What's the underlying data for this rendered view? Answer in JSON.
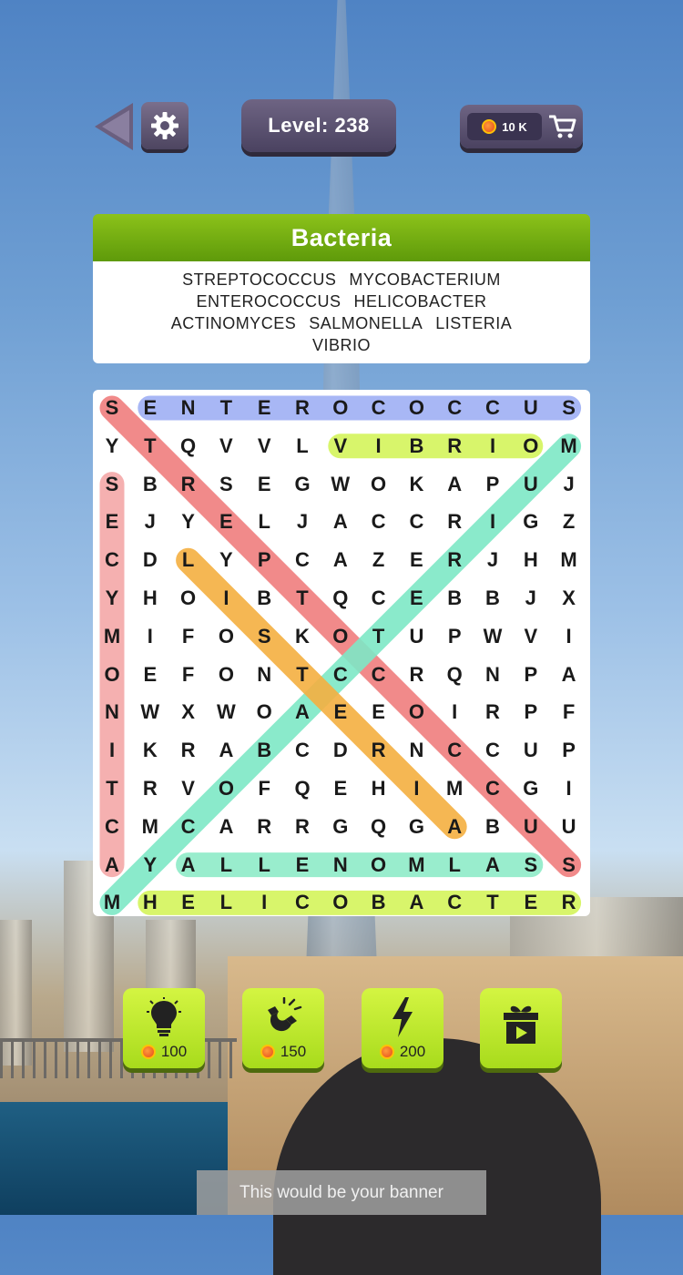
{
  "header": {
    "level_label": "Level: 238",
    "coins": "10 K",
    "icons": {
      "back": "back-arrow-icon",
      "settings": "gear-icon",
      "coin": "coin-icon",
      "cart": "shopping-cart-icon"
    }
  },
  "puzzle": {
    "category": "Bacteria",
    "words": [
      "STREPTOCOCCUS",
      "MYCOBACTERIUM",
      "ENTEROCOCCUS",
      "HELICOBACTER",
      "ACTINOMYCES",
      "SALMONELLA",
      "LISTERIA",
      "VIBRIO"
    ],
    "grid": [
      "SENTEROCOCCUS",
      "YTQVVLVIBRIOM",
      "SBRSEGWOKAPUJ",
      "EJYELJACCRIGZ",
      "CDLYPCAZERJHM",
      "YHOIBTQCEBBJX",
      "MIFOSKOTUPWVI",
      "OEFONTCCRQNPA",
      "NWXWOAEEOIRPF",
      "IKRABCDRNCCUP",
      "TRVOFQEHIMCGI",
      "CMCARRGQGABUU",
      "AYALLENOMLASS",
      "MHELICOBACTER"
    ],
    "found": [
      {
        "word": "ENTEROCOCCUS",
        "from": [
          0,
          1
        ],
        "to": [
          0,
          12
        ],
        "color": "#9fb0f5"
      },
      {
        "word": "VIBRIO",
        "from": [
          1,
          6
        ],
        "to": [
          1,
          11
        ],
        "color": "#d4f55c"
      },
      {
        "word": "STREPTOCOCCUS",
        "from": [
          0,
          0
        ],
        "to": [
          12,
          12
        ],
        "color": "#f07e7e"
      },
      {
        "word": "MYCOBACTERIUM",
        "from": [
          13,
          0
        ],
        "to": [
          1,
          12
        ],
        "color": "#7ee8c6"
      },
      {
        "word": "ACTINOMYCES",
        "from": [
          12,
          0
        ],
        "to": [
          2,
          0
        ],
        "color": "#f5a8a8"
      },
      {
        "word": "LISTERIA",
        "from": [
          4,
          2
        ],
        "to": [
          11,
          9
        ],
        "color": "#f5b041"
      },
      {
        "word": "SALMONELLA",
        "from": [
          12,
          11
        ],
        "to": [
          12,
          2
        ],
        "color": "#8fecc8"
      },
      {
        "word": "HELICOBACTER",
        "from": [
          13,
          1
        ],
        "to": [
          13,
          12
        ],
        "color": "#d4f55c"
      }
    ]
  },
  "powerups": [
    {
      "name": "hint",
      "icon": "lightbulb-icon",
      "cost": "100"
    },
    {
      "name": "magnet",
      "icon": "magnet-icon",
      "cost": "150"
    },
    {
      "name": "lightning",
      "icon": "lightning-icon",
      "cost": "200"
    },
    {
      "name": "video-gift",
      "icon": "gift-video-icon",
      "cost": ""
    }
  ],
  "banner": {
    "text": "This would be your banner"
  }
}
